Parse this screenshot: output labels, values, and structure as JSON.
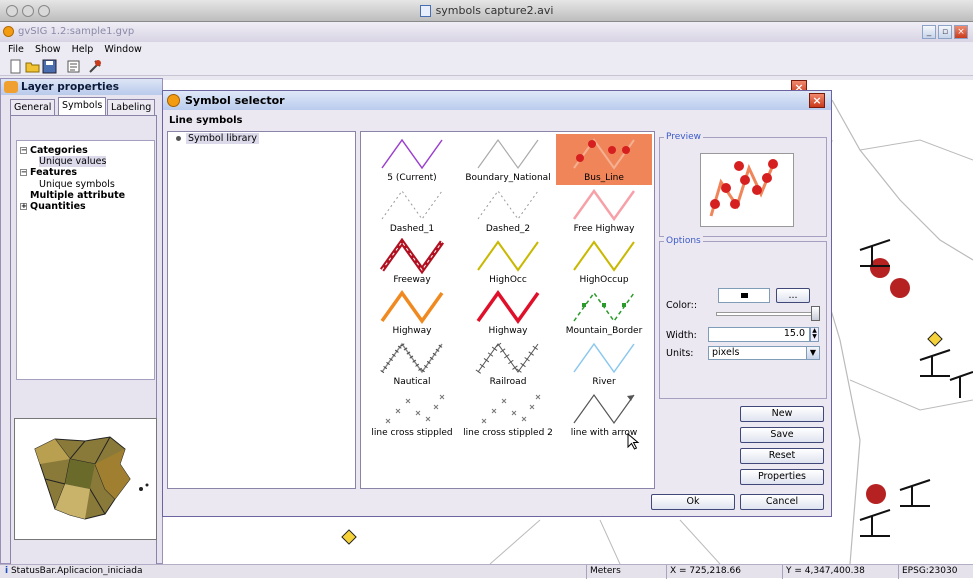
{
  "capture_title": "symbols capture2.avi",
  "app": {
    "title": "gvSIG 1.2:sample1.gvp",
    "menu": [
      "File",
      "Show",
      "Help",
      "Window"
    ]
  },
  "layer_properties": {
    "title": "Layer properties",
    "tabs": [
      "General",
      "Symbols",
      "Labeling"
    ],
    "selected_tab": "Symbols",
    "tree": [
      {
        "label": "Categories",
        "bold": true,
        "expander": "−"
      },
      {
        "label": "Unique values",
        "bold": false,
        "selected": true
      },
      {
        "label": "Features",
        "bold": true,
        "expander": "−"
      },
      {
        "label": "Unique symbols",
        "bold": false
      },
      {
        "label": "Multiple attribute",
        "bold": true
      },
      {
        "label": "Quantities",
        "bold": true,
        "expander": "+"
      }
    ]
  },
  "symbol_selector": {
    "title": "Symbol selector",
    "section": "Line symbols",
    "library_item": "Symbol library",
    "symbols": [
      {
        "label": "5 (Current)",
        "style": "purple"
      },
      {
        "label": "Boundary_National",
        "style": "gray"
      },
      {
        "label": "Bus_Line",
        "style": "bus",
        "selected": true
      },
      {
        "label": "Dashed_1",
        "style": "dashed"
      },
      {
        "label": "Dashed_2",
        "style": "dashed"
      },
      {
        "label": "Free Highway",
        "style": "pink"
      },
      {
        "label": "Freeway",
        "style": "freeway"
      },
      {
        "label": "HighOcc",
        "style": "yellow"
      },
      {
        "label": "HighOccup",
        "style": "yellow"
      },
      {
        "label": "Highway",
        "style": "orange"
      },
      {
        "label": "Highway",
        "style": "red"
      },
      {
        "label": "Mountain_Border",
        "style": "mountain"
      },
      {
        "label": "Nautical",
        "style": "nautical"
      },
      {
        "label": "Railroad",
        "style": "rail"
      },
      {
        "label": "River",
        "style": "river"
      },
      {
        "label": "line cross stippled",
        "style": "cross"
      },
      {
        "label": "line cross stippled 2",
        "style": "cross"
      },
      {
        "label": "line with arrow",
        "style": "arrow"
      }
    ],
    "preview_label": "Preview",
    "options_label": "Options",
    "color_label": "Color::",
    "color_button": "...",
    "width_label": "Width:",
    "width_value": "15.0",
    "units_label": "Units:",
    "units_value": "pixels",
    "buttons": {
      "new": "New",
      "save": "Save",
      "reset": "Reset",
      "properties": "Properties",
      "ok": "Ok",
      "cancel": "Cancel"
    }
  },
  "status": {
    "message": "StatusBar.Aplicacion_iniciada",
    "units": "Meters",
    "x": "X = 725,218.66",
    "y": "Y = 4,347,400.38",
    "crs": "EPSG:23030"
  },
  "colors": {
    "selection": "#f0855a",
    "title_blue": "#b9cbed",
    "accent_red": "#c93a1a"
  }
}
